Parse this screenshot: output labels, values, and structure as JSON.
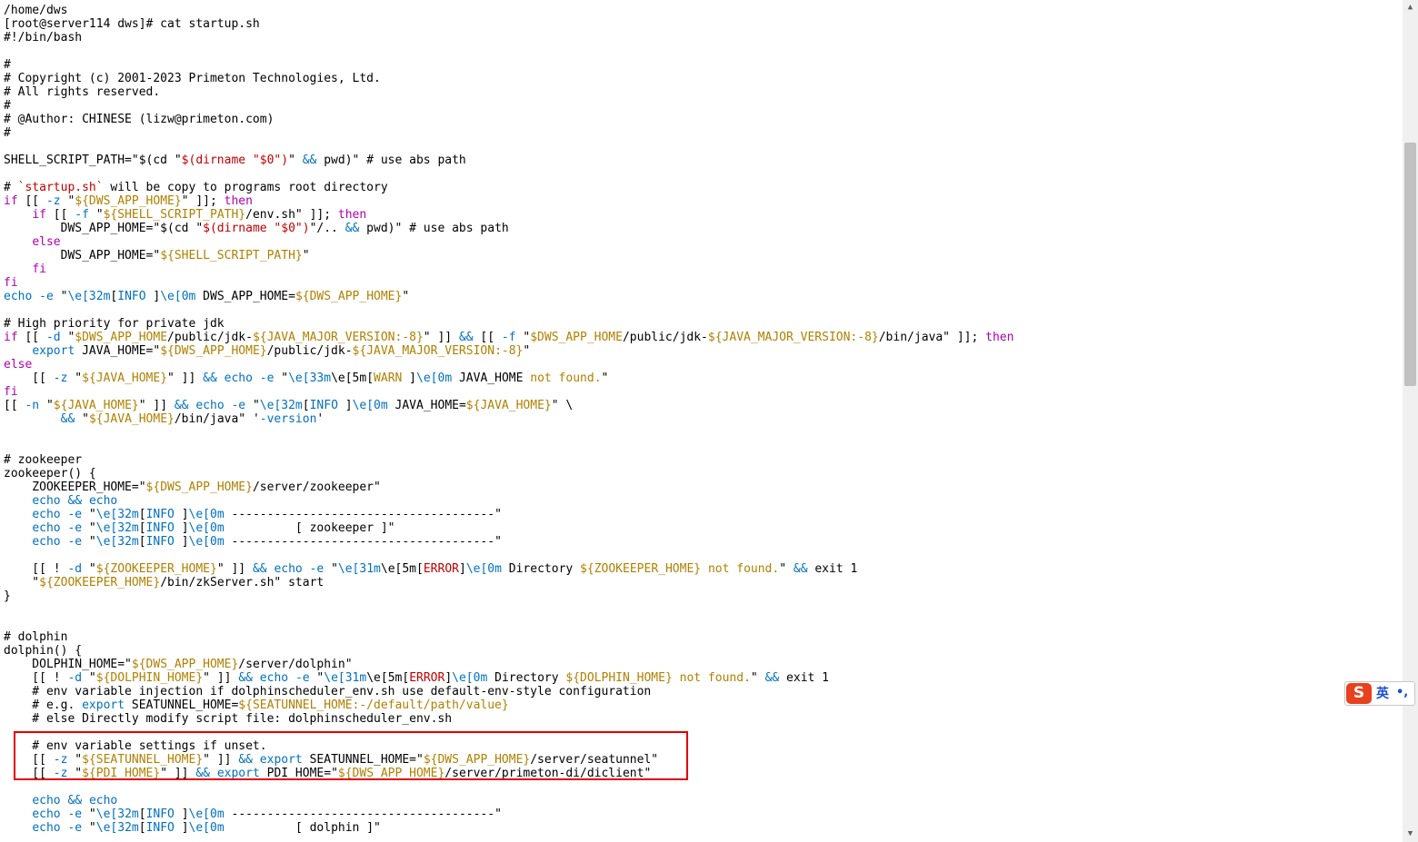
{
  "terminal": {
    "colors": {
      "text": "#000000",
      "keyword": "#b000b0",
      "builtin": "#0070c0",
      "variable": "#b08000",
      "error": "#c00000",
      "highlight_border": "#e00000"
    },
    "lines": [
      [
        [
          "c",
          "/home/dws"
        ]
      ],
      [
        [
          "c",
          "[root@server114 dws]# cat startup.sh"
        ]
      ],
      [
        [
          "c",
          "#!/bin/bash"
        ]
      ],
      [],
      [
        [
          "c",
          "#"
        ]
      ],
      [
        [
          "c",
          "# Copyright (c) 2001-2023 Primeton Technologies, Ltd."
        ]
      ],
      [
        [
          "c",
          "# All rights reserved."
        ]
      ],
      [
        [
          "c",
          "#"
        ]
      ],
      [
        [
          "c",
          "# @Author: CHINESE (lizw@primeton.com)"
        ]
      ],
      [
        [
          "c",
          "#"
        ]
      ],
      [],
      [
        [
          "c",
          "SHELL_SCRIPT_PATH=\"$(cd \""
        ],
        [
          "r",
          "$(dirname \"$0\")"
        ],
        [
          "c",
          "\" "
        ],
        [
          "b",
          "&&"
        ],
        [
          "c",
          " pwd)\" # use abs path"
        ]
      ],
      [],
      [
        [
          "c",
          "# "
        ],
        [
          "r",
          "`startup.sh`"
        ],
        [
          "c",
          " will be copy to programs root directory"
        ]
      ],
      [
        [
          "k",
          "if"
        ],
        [
          "c",
          " [[ "
        ],
        [
          "b",
          "-z"
        ],
        [
          "c",
          " \""
        ],
        [
          "y",
          "${DWS_APP_HOME}"
        ],
        [
          "c",
          "\" ]]; "
        ],
        [
          "k",
          "then"
        ]
      ],
      [
        [
          "c",
          "    "
        ],
        [
          "k",
          "if"
        ],
        [
          "c",
          " [[ "
        ],
        [
          "b",
          "-f"
        ],
        [
          "c",
          " \""
        ],
        [
          "y",
          "${SHELL_SCRIPT_PATH}"
        ],
        [
          "c",
          "/env.sh\" ]]; "
        ],
        [
          "k",
          "then"
        ]
      ],
      [
        [
          "c",
          "        DWS_APP_HOME=\"$(cd \""
        ],
        [
          "r",
          "$(dirname \"$0\")"
        ],
        [
          "c",
          "\"/.. "
        ],
        [
          "b",
          "&&"
        ],
        [
          "c",
          " pwd)\" # use abs path"
        ]
      ],
      [
        [
          "c",
          "    "
        ],
        [
          "k",
          "else"
        ]
      ],
      [
        [
          "c",
          "        DWS_APP_HOME=\""
        ],
        [
          "y",
          "${SHELL_SCRIPT_PATH}"
        ],
        [
          "c",
          "\""
        ]
      ],
      [
        [
          "c",
          "    "
        ],
        [
          "k",
          "fi"
        ]
      ],
      [
        [
          "k",
          "fi"
        ]
      ],
      [
        [
          "b",
          "echo"
        ],
        [
          "c",
          " "
        ],
        [
          "b",
          "-e"
        ],
        [
          "c",
          " \""
        ],
        [
          "b",
          "\\e[32m"
        ],
        [
          "c",
          "["
        ],
        [
          "b",
          "INFO"
        ],
        [
          "c",
          " ]"
        ],
        [
          "b",
          "\\e[0m"
        ],
        [
          "c",
          " DWS_APP_HOME="
        ],
        [
          "y",
          "${DWS_APP_HOME}"
        ],
        [
          "c",
          "\""
        ]
      ],
      [],
      [
        [
          "c",
          "# High priority for private jdk"
        ]
      ],
      [
        [
          "k",
          "if"
        ],
        [
          "c",
          " [[ "
        ],
        [
          "b",
          "-d"
        ],
        [
          "c",
          " \""
        ],
        [
          "y",
          "$DWS_APP_HOME"
        ],
        [
          "c",
          "/public/jdk-"
        ],
        [
          "y",
          "${JAVA_MAJOR_VERSION:-8}"
        ],
        [
          "c",
          "\" ]] "
        ],
        [
          "b",
          "&&"
        ],
        [
          "c",
          " [[ "
        ],
        [
          "b",
          "-f"
        ],
        [
          "c",
          " \""
        ],
        [
          "y",
          "$DWS_APP_HOME"
        ],
        [
          "c",
          "/public/jdk-"
        ],
        [
          "y",
          "${JAVA_MAJOR_VERSION:-8}"
        ],
        [
          "c",
          "/bin/java\" ]]; "
        ],
        [
          "k",
          "then"
        ]
      ],
      [
        [
          "c",
          "    "
        ],
        [
          "b",
          "export"
        ],
        [
          "c",
          " JAVA_HOME=\""
        ],
        [
          "y",
          "${DWS_APP_HOME}"
        ],
        [
          "c",
          "/public/jdk-"
        ],
        [
          "y",
          "${JAVA_MAJOR_VERSION:-8}"
        ],
        [
          "c",
          "\""
        ]
      ],
      [
        [
          "k",
          "else"
        ]
      ],
      [
        [
          "c",
          "    [[ "
        ],
        [
          "b",
          "-z"
        ],
        [
          "c",
          " \""
        ],
        [
          "y",
          "${JAVA_HOME}"
        ],
        [
          "c",
          "\" ]] "
        ],
        [
          "b",
          "&&"
        ],
        [
          "c",
          " "
        ],
        [
          "b",
          "echo"
        ],
        [
          "c",
          " "
        ],
        [
          "b",
          "-e"
        ],
        [
          "c",
          " \""
        ],
        [
          "b",
          "\\e[33m"
        ],
        [
          "c",
          "\\e[5m["
        ],
        [
          "y",
          "WARN"
        ],
        [
          "c",
          " ]"
        ],
        [
          "b",
          "\\e[0m"
        ],
        [
          "c",
          " JAVA_HOME "
        ],
        [
          "y",
          "not found."
        ],
        [
          "c",
          "\""
        ]
      ],
      [
        [
          "k",
          "fi"
        ]
      ],
      [
        [
          "c",
          "[[ "
        ],
        [
          "b",
          "-n"
        ],
        [
          "c",
          " \""
        ],
        [
          "y",
          "${JAVA_HOME}"
        ],
        [
          "c",
          "\" ]] "
        ],
        [
          "b",
          "&&"
        ],
        [
          "c",
          " "
        ],
        [
          "b",
          "echo"
        ],
        [
          "c",
          " "
        ],
        [
          "b",
          "-e"
        ],
        [
          "c",
          " \""
        ],
        [
          "b",
          "\\e[32m"
        ],
        [
          "c",
          "["
        ],
        [
          "b",
          "INFO"
        ],
        [
          "c",
          " ]"
        ],
        [
          "b",
          "\\e[0m"
        ],
        [
          "c",
          " JAVA_HOME="
        ],
        [
          "y",
          "${JAVA_HOME}"
        ],
        [
          "c",
          "\" \\"
        ]
      ],
      [
        [
          "c",
          "        "
        ],
        [
          "b",
          "&&"
        ],
        [
          "c",
          " \""
        ],
        [
          "y",
          "${JAVA_HOME}"
        ],
        [
          "c",
          "/bin/java\" '"
        ],
        [
          "b",
          "-version"
        ],
        [
          "c",
          "'"
        ]
      ],
      [],
      [],
      [
        [
          "c",
          "# zookeeper"
        ]
      ],
      [
        [
          "c",
          "zookeeper() {"
        ]
      ],
      [
        [
          "c",
          "    ZOOKEEPER_HOME=\""
        ],
        [
          "y",
          "${DWS_APP_HOME}"
        ],
        [
          "c",
          "/server/zookeeper\""
        ]
      ],
      [
        [
          "c",
          "    "
        ],
        [
          "b",
          "echo"
        ],
        [
          "c",
          " "
        ],
        [
          "b",
          "&&"
        ],
        [
          "c",
          " "
        ],
        [
          "b",
          "echo"
        ]
      ],
      [
        [
          "c",
          "    "
        ],
        [
          "b",
          "echo"
        ],
        [
          "c",
          " "
        ],
        [
          "b",
          "-e"
        ],
        [
          "c",
          " \""
        ],
        [
          "b",
          "\\e[32m"
        ],
        [
          "c",
          "["
        ],
        [
          "b",
          "INFO"
        ],
        [
          "c",
          " ]"
        ],
        [
          "b",
          "\\e[0m"
        ],
        [
          "c",
          " -------------------------------------\""
        ]
      ],
      [
        [
          "c",
          "    "
        ],
        [
          "b",
          "echo"
        ],
        [
          "c",
          " "
        ],
        [
          "b",
          "-e"
        ],
        [
          "c",
          " \""
        ],
        [
          "b",
          "\\e[32m"
        ],
        [
          "c",
          "["
        ],
        [
          "b",
          "INFO"
        ],
        [
          "c",
          " ]"
        ],
        [
          "b",
          "\\e[0m"
        ],
        [
          "c",
          "          [ zookeeper ]\""
        ]
      ],
      [
        [
          "c",
          "    "
        ],
        [
          "b",
          "echo"
        ],
        [
          "c",
          " "
        ],
        [
          "b",
          "-e"
        ],
        [
          "c",
          " \""
        ],
        [
          "b",
          "\\e[32m"
        ],
        [
          "c",
          "["
        ],
        [
          "b",
          "INFO"
        ],
        [
          "c",
          " ]"
        ],
        [
          "b",
          "\\e[0m"
        ],
        [
          "c",
          " -------------------------------------\""
        ]
      ],
      [],
      [
        [
          "c",
          "    [[ ! "
        ],
        [
          "b",
          "-d"
        ],
        [
          "c",
          " \""
        ],
        [
          "y",
          "${ZOOKEEPER_HOME}"
        ],
        [
          "c",
          "\" ]] "
        ],
        [
          "b",
          "&&"
        ],
        [
          "c",
          " "
        ],
        [
          "b",
          "echo"
        ],
        [
          "c",
          " "
        ],
        [
          "b",
          "-e"
        ],
        [
          "c",
          " \""
        ],
        [
          "b",
          "\\e[31m"
        ],
        [
          "c",
          "\\e[5m["
        ],
        [
          "r",
          "ERROR"
        ],
        [
          "c",
          "]"
        ],
        [
          "b",
          "\\e[0m"
        ],
        [
          "c",
          " Directory "
        ],
        [
          "y",
          "${ZOOKEEPER_HOME}"
        ],
        [
          "c",
          " "
        ],
        [
          "y",
          "not found."
        ],
        [
          "c",
          "\" "
        ],
        [
          "b",
          "&&"
        ],
        [
          "c",
          " exit 1"
        ]
      ],
      [
        [
          "c",
          "    \""
        ],
        [
          "y",
          "${ZOOKEEPER_HOME}"
        ],
        [
          "c",
          "/bin/zkServer.sh\" start"
        ]
      ],
      [
        [
          "c",
          "}"
        ]
      ],
      [],
      [],
      [
        [
          "c",
          "# dolphin"
        ]
      ],
      [
        [
          "c",
          "dolphin() {"
        ]
      ],
      [
        [
          "c",
          "    DOLPHIN_HOME=\""
        ],
        [
          "y",
          "${DWS_APP_HOME}"
        ],
        [
          "c",
          "/server/dolphin\""
        ]
      ],
      [
        [
          "c",
          "    [[ ! "
        ],
        [
          "b",
          "-d"
        ],
        [
          "c",
          " \""
        ],
        [
          "y",
          "${DOLPHIN_HOME}"
        ],
        [
          "c",
          "\" ]] "
        ],
        [
          "b",
          "&&"
        ],
        [
          "c",
          " "
        ],
        [
          "b",
          "echo"
        ],
        [
          "c",
          " "
        ],
        [
          "b",
          "-e"
        ],
        [
          "c",
          " \""
        ],
        [
          "b",
          "\\e[31m"
        ],
        [
          "c",
          "\\e[5m["
        ],
        [
          "r",
          "ERROR"
        ],
        [
          "c",
          "]"
        ],
        [
          "b",
          "\\e[0m"
        ],
        [
          "c",
          " Directory "
        ],
        [
          "y",
          "${DOLPHIN_HOME}"
        ],
        [
          "c",
          " "
        ],
        [
          "y",
          "not found."
        ],
        [
          "c",
          "\" "
        ],
        [
          "b",
          "&&"
        ],
        [
          "c",
          " exit 1"
        ]
      ],
      [
        [
          "c",
          "    # env variable injection if dolphinscheduler_env.sh use default-env-style configuration"
        ]
      ],
      [
        [
          "c",
          "    # e.g. "
        ],
        [
          "b",
          "export"
        ],
        [
          "c",
          " SEATUNNEL_HOME="
        ],
        [
          "y",
          "${SEATUNNEL_HOME:-/default/path/value}"
        ]
      ],
      [
        [
          "c",
          "    # else Directly modify script file: dolphinscheduler_env.sh"
        ]
      ],
      [],
      [
        [
          "c",
          "    # env variable settings if unset."
        ]
      ],
      [
        [
          "c",
          "    [[ "
        ],
        [
          "b",
          "-z"
        ],
        [
          "c",
          " \""
        ],
        [
          "y",
          "${SEATUNNEL_HOME}"
        ],
        [
          "c",
          "\" ]] "
        ],
        [
          "b",
          "&&"
        ],
        [
          "c",
          " "
        ],
        [
          "b",
          "export"
        ],
        [
          "c",
          " SEATUNNEL_HOME=\""
        ],
        [
          "y",
          "${DWS_APP_HOME}"
        ],
        [
          "c",
          "/server/seatunnel\""
        ]
      ],
      [
        [
          "c",
          "    [[ "
        ],
        [
          "b",
          "-z"
        ],
        [
          "c",
          " \""
        ],
        [
          "y",
          "${PDI_HOME}"
        ],
        [
          "c",
          "\" ]] "
        ],
        [
          "b",
          "&&"
        ],
        [
          "c",
          " "
        ],
        [
          "b",
          "export"
        ],
        [
          "c",
          " PDI_HOME=\""
        ],
        [
          "y",
          "${DWS_APP_HOME}"
        ],
        [
          "c",
          "/server/primeton-di/diclient\""
        ]
      ],
      [],
      [
        [
          "c",
          "    "
        ],
        [
          "b",
          "echo"
        ],
        [
          "c",
          " "
        ],
        [
          "b",
          "&&"
        ],
        [
          "c",
          " "
        ],
        [
          "b",
          "echo"
        ]
      ],
      [
        [
          "c",
          "    "
        ],
        [
          "b",
          "echo"
        ],
        [
          "c",
          " "
        ],
        [
          "b",
          "-e"
        ],
        [
          "c",
          " \""
        ],
        [
          "b",
          "\\e[32m"
        ],
        [
          "c",
          "["
        ],
        [
          "b",
          "INFO"
        ],
        [
          "c",
          " ]"
        ],
        [
          "b",
          "\\e[0m"
        ],
        [
          "c",
          " -------------------------------------\""
        ]
      ],
      [
        [
          "c",
          "    "
        ],
        [
          "b",
          "echo"
        ],
        [
          "c",
          " "
        ],
        [
          "b",
          "-e"
        ],
        [
          "c",
          " \""
        ],
        [
          "b",
          "\\e[32m"
        ],
        [
          "c",
          "["
        ],
        [
          "b",
          "INFO"
        ],
        [
          "c",
          " ]"
        ],
        [
          "b",
          "\\e[0m"
        ],
        [
          "c",
          "          [ dolphin ]\""
        ]
      ]
    ]
  },
  "scrollbar": {
    "up_icon": "scroll-up-arrow-icon",
    "down_icon": "scroll-down-arrow-icon",
    "up_glyph": "▲",
    "down_glyph": "▼"
  },
  "ime": {
    "logo_icon": "sogou-ime-icon",
    "logo_glyph": "S",
    "lang_label": "英",
    "punct_label": "•,"
  }
}
